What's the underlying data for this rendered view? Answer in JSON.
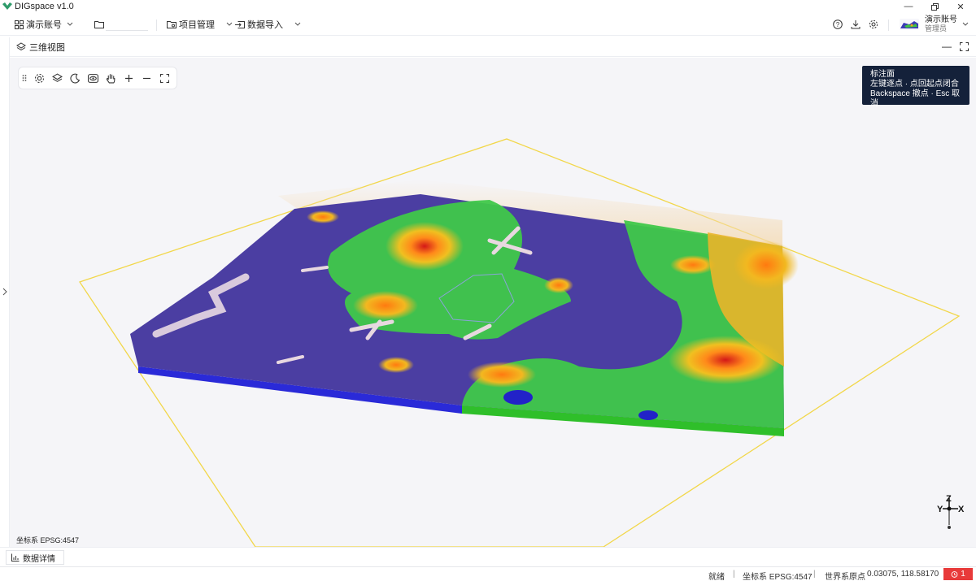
{
  "app": {
    "title": "DIGspace v1.0"
  },
  "menubar": {
    "account_label": "演示账号",
    "project_label": "项目管理",
    "import_label": "数据导入",
    "user_name": "演示账号",
    "user_role": "管理员"
  },
  "panel": {
    "title": "三维视图"
  },
  "viewport": {
    "tooltip": {
      "title": "标注面",
      "line1": "左键逐点 · 点回起点闭合",
      "line2": "Backspace 撤点 · Esc 取消"
    },
    "coord_label": "坐标系 EPSG:4547",
    "axis": {
      "x": "X",
      "y": "Y",
      "z": "Z"
    }
  },
  "bottom": {
    "data_tab": "数据详情"
  },
  "status": {
    "ready": "就绪",
    "crs": "坐标系 EPSG:4547",
    "origin_label": "世界系原点",
    "origin_value": "0.03075, 118.58170",
    "error_count": "1"
  },
  "colors": {
    "accent_dark": "#14213a",
    "error": "#e83a3a",
    "outline_yellow": "#f2d74a"
  },
  "icons": [
    "app-logo-icon",
    "grid-icon",
    "folder-icon",
    "folder-settings-icon",
    "import-icon",
    "help-icon",
    "download-icon",
    "gear-icon",
    "layers-icon",
    "moon-icon",
    "eye-icon",
    "hand-icon",
    "plus-icon",
    "minus-icon",
    "fullscreen-icon",
    "chart-icon",
    "alarm-icon"
  ]
}
